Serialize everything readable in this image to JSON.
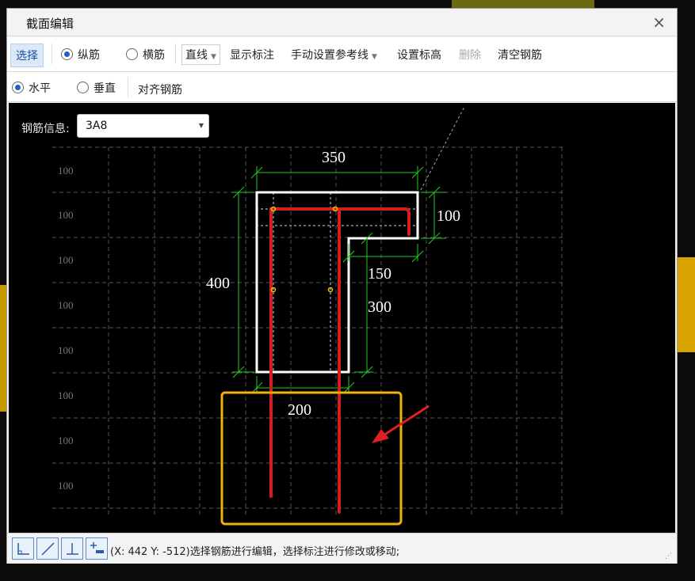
{
  "dialog": {
    "title": "截面编辑",
    "close": "×"
  },
  "toolbar": {
    "select_label": "选择",
    "longitudinal_label": "纵筋",
    "transverse_label": "横筋",
    "linetype_label": "直线",
    "show_annotation_label": "显示标注",
    "manual_ref_line_label": "手动设置参考线",
    "set_elevation_label": "设置标高",
    "delete_label": "删除",
    "clear_rebar_label": "清空钢筋"
  },
  "toolbar2": {
    "horizontal_label": "水平",
    "vertical_label": "垂直",
    "align_rebar_label": "对齐钢筋"
  },
  "rebar_info": {
    "label": "钢筋信息:",
    "value": "3A8"
  },
  "grid_labels": [
    "100",
    "100",
    "100",
    "100",
    "100",
    "100",
    "100",
    "100"
  ],
  "dimensions": {
    "top_width": "350",
    "flange_height": "100",
    "total_height": "400",
    "web_offset": "150",
    "web_height": "300",
    "bottom_width": "200"
  },
  "colors": {
    "section_outline": "#ffffff",
    "dimension": "#22cc22",
    "rebar": "#d11f1f",
    "highlight_box": "#f2b20c",
    "arrow": "#e02020",
    "grid": "#5a5a5a"
  },
  "status": {
    "text": "(X: 442 Y: -512)选择钢筋进行编辑，选择标注进行修改或移动;"
  }
}
